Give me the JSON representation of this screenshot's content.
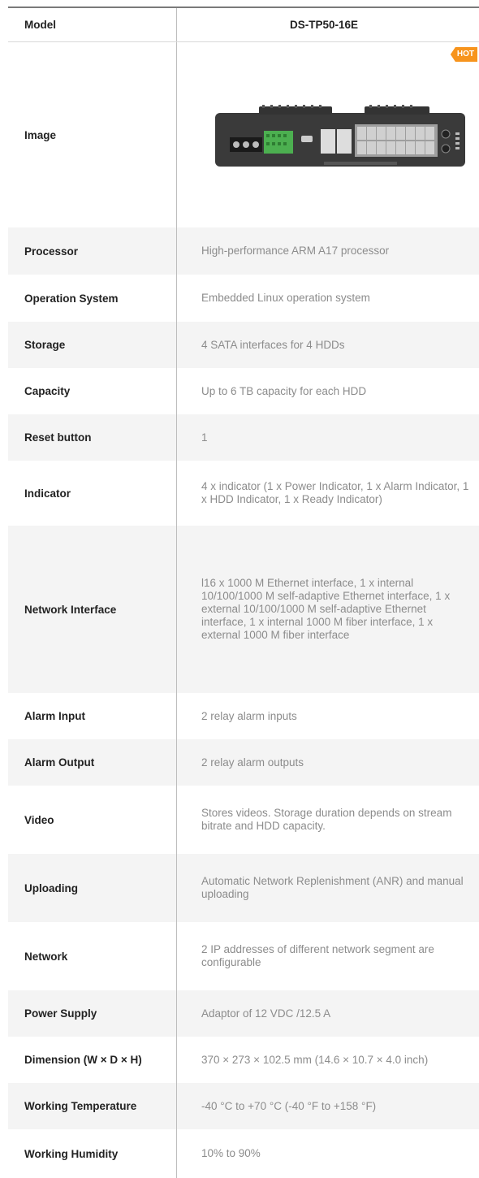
{
  "header": {
    "label": "Model",
    "value": "DS-TP50-16E"
  },
  "image_row": {
    "label": "Image",
    "badge": "HOT"
  },
  "specs": [
    {
      "label": "Processor",
      "value": "High-performance ARM A17 processor"
    },
    {
      "label": "Operation System",
      "value": "Embedded Linux operation system"
    },
    {
      "label": "Storage",
      "value": "4 SATA interfaces for 4 HDDs"
    },
    {
      "label": "Capacity",
      "value": "Up to 6 TB capacity for each HDD"
    },
    {
      "label": "Reset button",
      "value": "1"
    },
    {
      "label": "Indicator",
      "value": "4 x indicator (1 x Power Indicator, 1 x Alarm Indicator, 1 x HDD Indicator, 1 x Ready Indicator)"
    },
    {
      "label": "Network Interface",
      "value": "l16 x 1000 M Ethernet interface, 1 x internal 10/100/1000 M self-adaptive Ethernet interface, 1 x external 10/100/1000 M self-adaptive Ethernet interface, 1 x internal 1000 M fiber interface, 1 x external 1000 M fiber interface"
    },
    {
      "label": "Alarm Input",
      "value": "2 relay alarm inputs"
    },
    {
      "label": "Alarm Output",
      "value": "2 relay alarm outputs"
    },
    {
      "label": "Video",
      "value": "Stores videos. Storage duration depends on stream bitrate and HDD capacity."
    },
    {
      "label": "Uploading",
      "value": "Automatic Network Replenishment (ANR) and manual uploading"
    },
    {
      "label": "Network",
      "value": "2 IP addresses of different network segment are configurable"
    },
    {
      "label": "Power Supply",
      "value": "Adaptor of 12 VDC /12.5 A"
    },
    {
      "label": "Dimension (W × D × H)",
      "value": "370 × 273 × 102.5 mm (14.6 × 10.7 × 4.0 inch)"
    },
    {
      "label": "Working Temperature",
      "value": "-40 °C to +70 °C (-40 °F to +158 °F)"
    },
    {
      "label": "Working Humidity",
      "value": "10% to 90%"
    }
  ],
  "colors": {
    "badge": "#f7941d",
    "stripe": "#f4f4f4",
    "device_body": "#3a3a3a",
    "terminal_green": "#4caf50"
  }
}
